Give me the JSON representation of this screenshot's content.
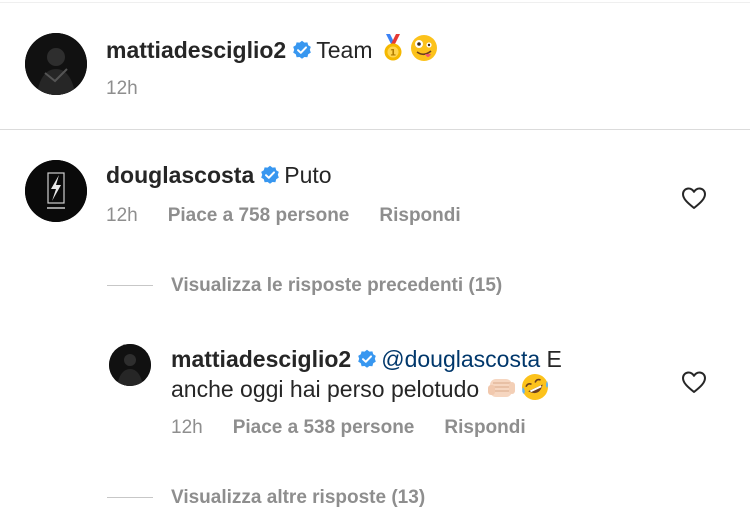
{
  "caption": {
    "username": "mattiadesciglio2",
    "text": "Team",
    "emojis": [
      "medal",
      "zany-face"
    ],
    "time": "12h"
  },
  "comment": {
    "username": "douglascosta",
    "text": "Puto",
    "time": "12h",
    "likes": "Piace a 758 persone",
    "reply": "Rispondi"
  },
  "view_previous": "Visualizza le risposte precedenti (15)",
  "reply": {
    "username": "mattiadesciglio2",
    "mention": "@douglascosta",
    "text_line1_tail": "E",
    "text_line2": "anche oggi hai perso pelotudo",
    "emojis": [
      "fist",
      "rofl"
    ],
    "time": "12h",
    "likes": "Piace a 538 persone",
    "reply": "Rispondi"
  },
  "view_more": "Visualizza altre risposte (13)",
  "colors": {
    "verified": "#3897f0",
    "mention": "#00376b",
    "meta": "#8e8e8e"
  }
}
